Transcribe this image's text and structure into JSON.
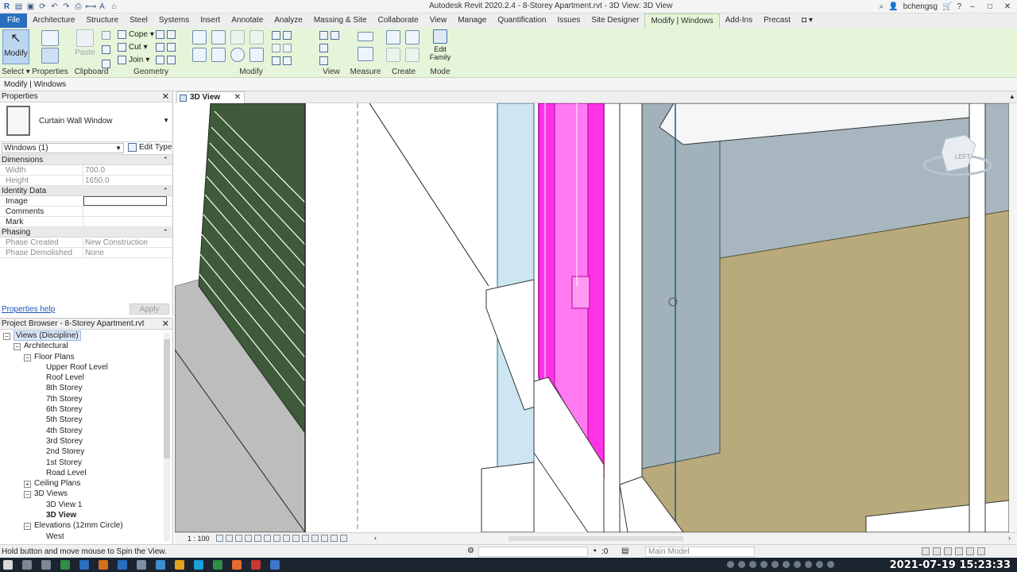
{
  "titlebar": {
    "title": "Autodesk Revit 2020.2.4 - 8-Storey Apartment.rvt - 3D View: 3D View",
    "user": "bchengsg"
  },
  "ribbon_tabs": [
    "File",
    "Architecture",
    "Structure",
    "Steel",
    "Systems",
    "Insert",
    "Annotate",
    "Analyze",
    "Massing & Site",
    "Collaborate",
    "View",
    "Manage",
    "Quantification",
    "Issues",
    "Site Designer",
    "Modify | Windows",
    "Add-Ins",
    "Precast"
  ],
  "ribbon": {
    "modify_label": "Modify",
    "clipboard": {
      "paste": "Paste",
      "cope": "Cope",
      "cut": "Cut",
      "join": "Join"
    },
    "panels": {
      "select": "Select",
      "properties": "Properties",
      "clipboard": "Clipboard",
      "geometry": "Geometry",
      "modify": "Modify",
      "view": "View",
      "measure": "Measure",
      "create": "Create",
      "mode": "Mode"
    },
    "edit_family": "Edit Family"
  },
  "options_bar": {
    "context": "Modify | Windows"
  },
  "properties": {
    "header": "Properties",
    "type_name": "Curtain Wall Window",
    "instance_filter": "Windows (1)",
    "edit_type": "Edit Type",
    "sections": {
      "dimensions": "Dimensions",
      "identity": "Identity Data",
      "phasing": "Phasing"
    },
    "rows": {
      "width": {
        "label": "Width",
        "value": "700.0"
      },
      "height": {
        "label": "Height",
        "value": "1650.0"
      },
      "image": {
        "label": "Image",
        "value": ""
      },
      "comments": {
        "label": "Comments",
        "value": ""
      },
      "mark": {
        "label": "Mark",
        "value": ""
      },
      "phase_created": {
        "label": "Phase Created",
        "value": "New Construction"
      },
      "phase_demolished": {
        "label": "Phase Demolished",
        "value": "None"
      }
    },
    "help": "Properties help",
    "apply": "Apply"
  },
  "browser": {
    "header": "Project Browser - 8-Storey Apartment.rvt",
    "items": [
      {
        "label": "Views (Discipline)",
        "toggle": "−"
      },
      {
        "label": "Architectural",
        "toggle": "−"
      },
      {
        "label": "Floor Plans",
        "toggle": "−"
      },
      {
        "label": "Upper Roof Level"
      },
      {
        "label": "Roof Level"
      },
      {
        "label": "8th Storey"
      },
      {
        "label": "7th Storey"
      },
      {
        "label": "6th Storey"
      },
      {
        "label": "5th Storey"
      },
      {
        "label": "4th Storey"
      },
      {
        "label": "3rd Storey"
      },
      {
        "label": "2nd Storey"
      },
      {
        "label": "1st Storey"
      },
      {
        "label": "Road Level"
      },
      {
        "label": "Ceiling Plans",
        "toggle": "+"
      },
      {
        "label": "3D Views",
        "toggle": "−"
      },
      {
        "label": "3D View 1"
      },
      {
        "label": "3D View"
      },
      {
        "label": "Elevations (12mm Circle)",
        "toggle": "−"
      },
      {
        "label": "West"
      }
    ]
  },
  "view": {
    "tab_label": "3D View",
    "viewcube_label": "LEFT",
    "scale": "1 : 100"
  },
  "status": {
    "message": "Hold button and move mouse to Spin the View.",
    "zero": ":0",
    "model": "Main Model"
  },
  "taskbar": {
    "clock": "2021-07-19  15:23:33"
  },
  "colors": {
    "ribbon_bg": "#e6f4d9",
    "selection_magenta": "#ff33e6",
    "wall_tan": "#b9aa7b",
    "wall_grey": "#a8b7bf",
    "glass_blue": "#cde6f2",
    "louver_green": "#3e5a3a"
  }
}
